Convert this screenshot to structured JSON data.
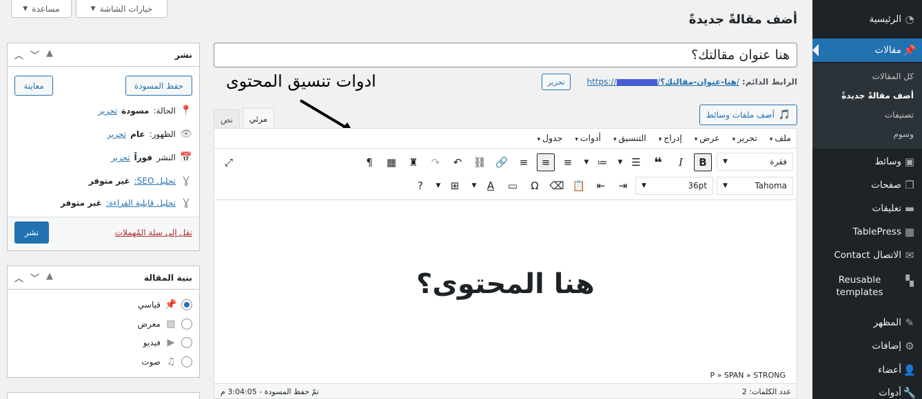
{
  "top_buttons": {
    "screen_options": "خيارات الشاشة",
    "help": "مساعدة"
  },
  "page": {
    "heading": "أضف مقالةً جديدةً"
  },
  "sidebar": {
    "items": [
      {
        "label": "الرئيسية",
        "icon": "dashboard-icon"
      },
      {
        "label": "مقالات",
        "icon": "pin-icon",
        "active": true
      },
      {
        "label": "وسائط",
        "icon": "media-icon"
      },
      {
        "label": "صفحات",
        "icon": "pages-icon"
      },
      {
        "label": "تعليقات",
        "icon": "comments-icon"
      },
      {
        "label": "TablePress",
        "icon": "table-icon"
      },
      {
        "label": "الاتصال Contact",
        "icon": "mail-icon"
      },
      {
        "label": "Reusable templates",
        "icon": "blocks-icon"
      },
      {
        "label": "المظهر",
        "icon": "brush-icon"
      },
      {
        "label": "إضافات",
        "icon": "plugin-icon"
      },
      {
        "label": "أعضاء",
        "icon": "user-icon"
      },
      {
        "label": "أدوات",
        "icon": "wrench-icon"
      }
    ],
    "submenu": [
      "كل المقالات",
      "أضف مقالةً جديدةً",
      "تصنيفات",
      "وسوم"
    ]
  },
  "title_field": {
    "value": "هنا عنوان مقالتك؟"
  },
  "permalink": {
    "label": "الرابط الدائم:",
    "url_prefix": "https://",
    "url_hidden": "xxxxxxx.com",
    "slug": "هنا-عنوان-مقالتك؟",
    "url_suffix": "/",
    "edit_button": "تحرير"
  },
  "annotation": {
    "text": "ادوات تنسيق المحتوى"
  },
  "media_button": "أضف ملفات وسائط",
  "tabs": {
    "visual": "مرئي",
    "text": "نص"
  },
  "menubar": [
    "ملف",
    "تحرير",
    "عرض",
    "إدراج",
    "التنسيق",
    "أدوات",
    "جدول"
  ],
  "toolbar": {
    "format": "فقرة",
    "font": "Tahoma",
    "size": "36pt"
  },
  "content": {
    "text": "هنا المحتوى؟"
  },
  "status_bar": {
    "path": "P » SPAN » STRONG",
    "word_count": "عدد الكلمات: 2",
    "saved": "تمّ حفظ المسودة - 3:04:05 م"
  },
  "publish_box": {
    "title": "نشر",
    "save_draft": "حفظ المسودة",
    "preview": "معاينة",
    "status_label": "الحالة:",
    "status_value": "مسودة",
    "status_edit": "تحرير",
    "visibility_label": "الظهور:",
    "visibility_value": "عام",
    "visibility_edit": "تحرير",
    "publish_label": "النشر",
    "publish_value": "فوراً",
    "publish_edit": "تحرير",
    "seo_link": "تحليل SEO:",
    "seo_value": "غير متوفر",
    "read_link": "تحليل قابلية القراءة:",
    "read_value": "غير متوفر",
    "trash": "نقل إلى سلة المُهملات",
    "publish": "نشر"
  },
  "format_box": {
    "title": "بنية المقالة",
    "options": [
      {
        "label": "قياسي",
        "checked": true
      },
      {
        "label": "معرض"
      },
      {
        "label": "فيديو"
      },
      {
        "label": "صوت"
      }
    ]
  },
  "colors": {
    "accent": "#2271b1",
    "sidebar": "#1d2327"
  }
}
